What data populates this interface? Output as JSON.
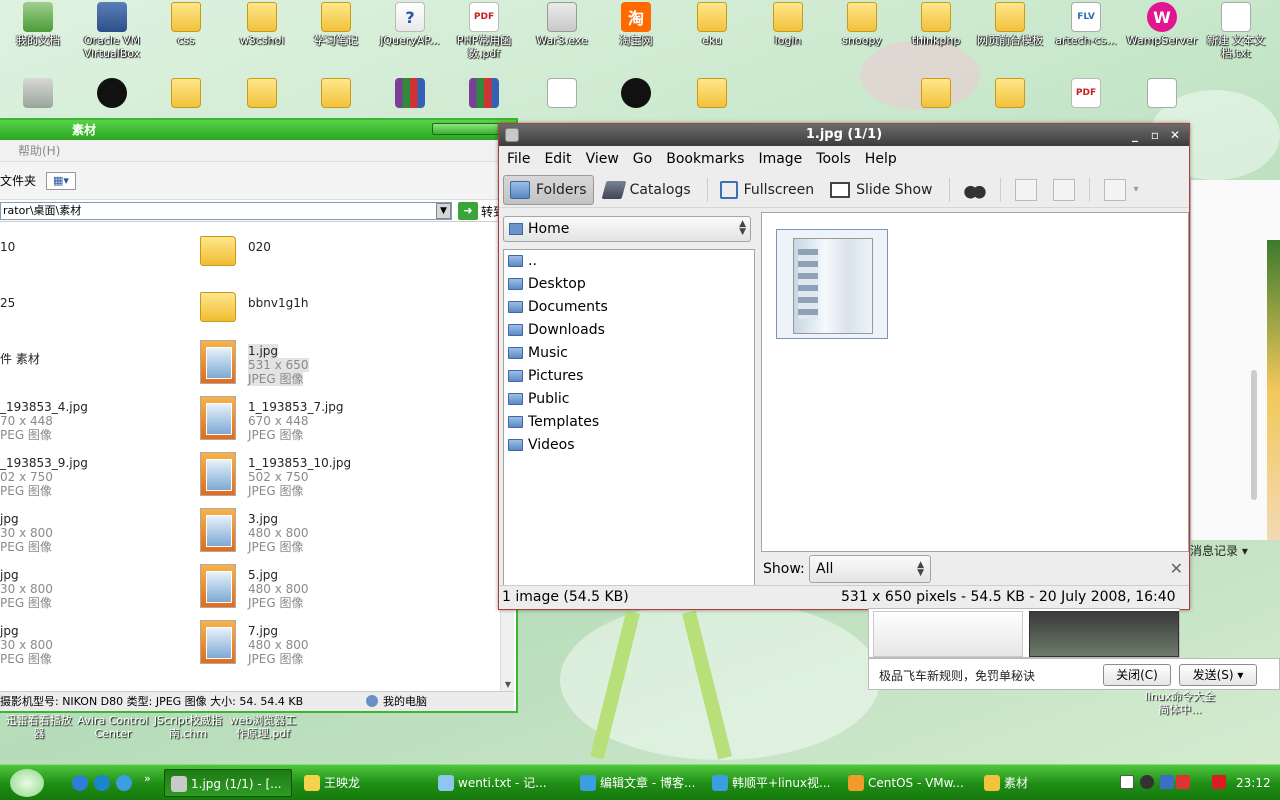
{
  "desktop": {
    "row1": [
      {
        "label": "我的文档",
        "icon": "my-documents-icon",
        "kind": "pc"
      },
      {
        "label": "Oracle VM VirtualBox",
        "icon": "virtualbox-icon",
        "kind": "vbox"
      },
      {
        "label": "css",
        "icon": "folder-icon",
        "kind": "folder"
      },
      {
        "label": "w3cshol",
        "icon": "folder-icon",
        "kind": "folder"
      },
      {
        "label": "学习笔记",
        "icon": "folder-icon",
        "kind": "folder"
      },
      {
        "label": "jQueryAP...",
        "icon": "help-file-icon",
        "kind": "help"
      },
      {
        "label": "PHP常用函数.pdf",
        "icon": "pdf-icon",
        "kind": "pdf"
      },
      {
        "label": "War3.exe",
        "icon": "exe-icon",
        "kind": "exe"
      },
      {
        "label": "淘宝网",
        "icon": "taobao-icon",
        "kind": "taobao"
      },
      {
        "label": "eku",
        "icon": "folder-icon",
        "kind": "folder"
      },
      {
        "label": "login",
        "icon": "folder-icon",
        "kind": "folder"
      },
      {
        "label": "snoopy",
        "icon": "folder-icon",
        "kind": "folder"
      },
      {
        "label": "thinkphp",
        "icon": "folder-icon",
        "kind": "folder"
      },
      {
        "label": "网页前台模板",
        "icon": "folder-icon",
        "kind": "folder"
      },
      {
        "label": "artech-cs...",
        "icon": "flv-file-icon",
        "kind": "flv"
      },
      {
        "label": "WampServer",
        "icon": "wampserver-icon",
        "kind": "wamp"
      },
      {
        "label": "新建 文本文档.txt",
        "icon": "text-file-icon",
        "kind": "txt"
      }
    ],
    "row2": [
      {
        "label": "",
        "icon": "recycle-bin-icon",
        "kind": "trash"
      },
      {
        "label": "",
        "icon": "qq-penguin-icon",
        "kind": "qq"
      },
      {
        "label": "",
        "icon": "folder-icon",
        "kind": "folder"
      },
      {
        "label": "",
        "icon": "folder-icon",
        "kind": "folder"
      },
      {
        "label": "",
        "icon": "folder-icon",
        "kind": "folder"
      },
      {
        "label": "",
        "icon": "winrar-icon",
        "kind": "rar"
      },
      {
        "label": "",
        "icon": "winrar-icon",
        "kind": "rar"
      },
      {
        "label": "",
        "icon": "office-doc-icon",
        "kind": "ppt"
      },
      {
        "label": "",
        "icon": "qq-icon",
        "kind": "qq"
      },
      {
        "label": "",
        "icon": "folder-icon",
        "kind": "folder"
      },
      {
        "label": "",
        "icon": "folder-icon",
        "kind": "folder"
      },
      {
        "label": "",
        "icon": "folder-icon",
        "kind": "folder"
      },
      {
        "label": "",
        "icon": "pdf-icon",
        "kind": "pdf"
      },
      {
        "label": "",
        "icon": "text-file-icon",
        "kind": "txt"
      }
    ],
    "bottom_labels": [
      "迅雷看看播放器",
      "Avira Control Center",
      "JScript校威指南.chm",
      "web浏览器工作原理.pdf"
    ],
    "right_label": "linux命令大全 简体中..."
  },
  "explorer": {
    "title": "素材",
    "menu_help": "帮助(H)",
    "toolbar_folders": "文件夹",
    "address": "rator\\桌面\\素材",
    "go_label": "转到",
    "status_text": "摄影机型号: NIKON D80 类型: JPEG 图像 大小: 54. 54.4 KB",
    "status_computer": "我的电脑",
    "files_left": [
      {
        "name": "10",
        "l2": "",
        "l3": ""
      },
      {
        "name": "25",
        "l2": "",
        "l3": ""
      },
      {
        "name": "件 素材",
        "l2": "",
        "l3": ""
      },
      {
        "name": "_193853_4.jpg",
        "l2": "70 x 448",
        "l3": "PEG 图像"
      },
      {
        "name": "_193853_9.jpg",
        "l2": "02 x 750",
        "l3": "PEG 图像"
      },
      {
        "name": "jpg",
        "l2": "30 x 800",
        "l3": "PEG 图像"
      },
      {
        "name": "jpg",
        "l2": "30 x 800",
        "l3": "PEG 图像"
      },
      {
        "name": "jpg",
        "l2": "30 x 800",
        "l3": "PEG 图像"
      }
    ],
    "files_right": [
      {
        "name": "020",
        "l2": "",
        "l3": "",
        "type": "folder"
      },
      {
        "name": "bbnv1g1h",
        "l2": "",
        "l3": "",
        "type": "folder"
      },
      {
        "name": "1.jpg",
        "l2": "531 x 650",
        "l3": "JPEG 图像",
        "type": "image"
      },
      {
        "name": "1_193853_7.jpg",
        "l2": "670 x 448",
        "l3": "JPEG 图像",
        "type": "image"
      },
      {
        "name": "1_193853_10.jpg",
        "l2": "502 x 750",
        "l3": "JPEG 图像",
        "type": "image"
      },
      {
        "name": "3.jpg",
        "l2": "480 x 800",
        "l3": "JPEG 图像",
        "type": "image"
      },
      {
        "name": "5.jpg",
        "l2": "480 x 800",
        "l3": "JPEG 图像",
        "type": "image"
      },
      {
        "name": "7.jpg",
        "l2": "480 x 800",
        "l3": "JPEG 图像",
        "type": "image"
      }
    ]
  },
  "gthumb": {
    "title": "1.jpg  (1/1)",
    "menu": [
      "File",
      "Edit",
      "View",
      "Go",
      "Bookmarks",
      "Image",
      "Tools",
      "Help"
    ],
    "toolbar": {
      "folders": "Folders",
      "catalogs": "Catalogs",
      "fullscreen": "Fullscreen",
      "slideshow": "Slide Show"
    },
    "location": "Home",
    "folders": [
      "..",
      "Desktop",
      "Documents",
      "Downloads",
      "Music",
      "Pictures",
      "Public",
      "Templates",
      "Videos"
    ],
    "show_label": "Show:",
    "show_value": "All",
    "status_left": "1 image (54.5 KB)",
    "status_right": "531 x 650 pixels - 54.5 KB - 20 July 2008, 16:40"
  },
  "chat": {
    "history": "消息记录",
    "news": "极品飞车新规则，免罚单秘诀",
    "close": "关闭(C)",
    "send": "发送(S)"
  },
  "taskbar": {
    "items": [
      {
        "label": "1.jpg  (1/1) - [...",
        "icon": "gthumb-icon",
        "active": true
      },
      {
        "label": "王映龙",
        "icon": "notes-icon",
        "active": false
      },
      {
        "label": "wenti.txt - 记...",
        "icon": "notepad-icon",
        "active": false
      },
      {
        "label": "编辑文章 - 博客...",
        "icon": "browser-icon",
        "active": false
      },
      {
        "label": "韩顺平+linux视...",
        "icon": "browser-icon",
        "active": false
      },
      {
        "label": "CentOS - VMw...",
        "icon": "vmware-icon",
        "active": false
      },
      {
        "label": "素材",
        "icon": "folder-icon",
        "active": false
      }
    ],
    "clock": "23:12"
  }
}
